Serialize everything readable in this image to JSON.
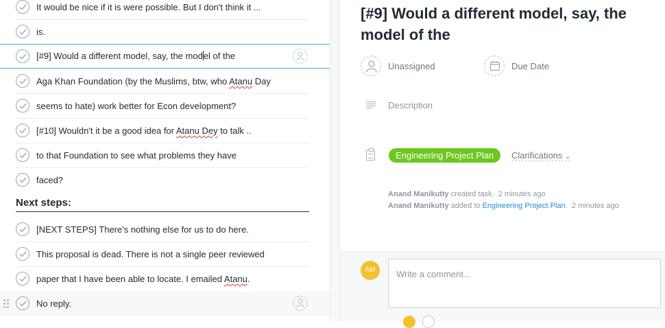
{
  "tasks": [
    {
      "text": "It would be nice if it is were possible. But I don't think it ..."
    },
    {
      "text": "is."
    },
    {
      "text_a": "[#9] Would a different model, say, the mod",
      "text_b": "el of the"
    },
    {
      "text_a": "Aga Khan Foundation (by the Muslims, btw, who ",
      "squiggle": "Atanu",
      "text_b": " Day"
    },
    {
      "text": "seems to hate) work better for Econ development?"
    },
    {
      "text_a": "[#10] Wouldn't it be a good idea for ",
      "squiggle": "Atanu Dey",
      "text_b": " to talk .."
    },
    {
      "text": "to that Foundation to see what problems they have"
    },
    {
      "text": "faced?"
    }
  ],
  "section": {
    "label": "Next steps:"
  },
  "tasks_after": [
    {
      "text": "[NEXT STEPS] There's nothing else for us to do here."
    },
    {
      "text": "This proposal is dead. There is not a single peer reviewed"
    },
    {
      "text_a": "paper that I have been able to locate. I emailed ",
      "squiggle": "Atanu",
      "text_b": "."
    },
    {
      "text": "No reply."
    }
  ],
  "detail": {
    "title": "[#9] Would a different model, say, the model of the",
    "assignee": "Unassigned",
    "due_date": "Due Date",
    "description_placeholder": "Description",
    "project": "Engineering Project Plan",
    "project_color": "#6cc71f",
    "section": "Clarifications",
    "stories": [
      {
        "actor": "Anand Manikutty",
        "action": " created task.",
        "time": "2 minutes ago"
      },
      {
        "actor": "Anand Manikutty",
        "action": " added to ",
        "link": "Engineering Project Plan",
        "end": ".",
        "time": "2 minutes ago"
      }
    ]
  },
  "comment": {
    "avatar_initials": "AM",
    "avatar_color": "#f2c12e",
    "placeholder": "Write a comment..."
  },
  "accent_color": "#4aaee3"
}
